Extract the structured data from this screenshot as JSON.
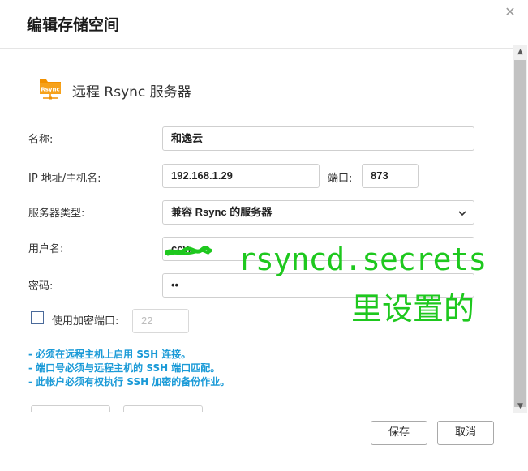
{
  "dialog": {
    "title": "编辑存储空间",
    "close_glyph": "✕"
  },
  "header": {
    "icon_text": "Rsync",
    "text": "远程 Rsync 服务器",
    "icon_color": "#f29100"
  },
  "form": {
    "name_label": "名称:",
    "name_value": "和逸云",
    "host_label": "IP 地址/主机名:",
    "host_value": "192.168.1.29",
    "port_label": "端口:",
    "port_value": "873",
    "server_type_label": "服务器类型:",
    "server_type_value": "兼容 Rsync 的服务器",
    "username_label": "用户名:",
    "username_value": "ccv...",
    "password_label": "密码:",
    "password_value": "••",
    "encrypt_port_label": "使用加密端口:",
    "encrypt_port_placeholder": "22",
    "encrypt_checked": false
  },
  "notes": [
    "- 必须在远程主机上启用 SSH 连接。",
    "- 端口号必须与远程主机的 SSH 端口匹配。",
    "- 此帐户必须有权执行 SSH 加密的备份作业。"
  ],
  "footer": {
    "save_label": "保存",
    "cancel_label": "取消"
  },
  "annotation": {
    "line1": "rsyncd.secrets",
    "line2": "里设置的",
    "color": "#1ec81e"
  },
  "colors": {
    "note_blue": "#1a9ad7",
    "scrollbar_thumb": "#c2c2c2"
  }
}
